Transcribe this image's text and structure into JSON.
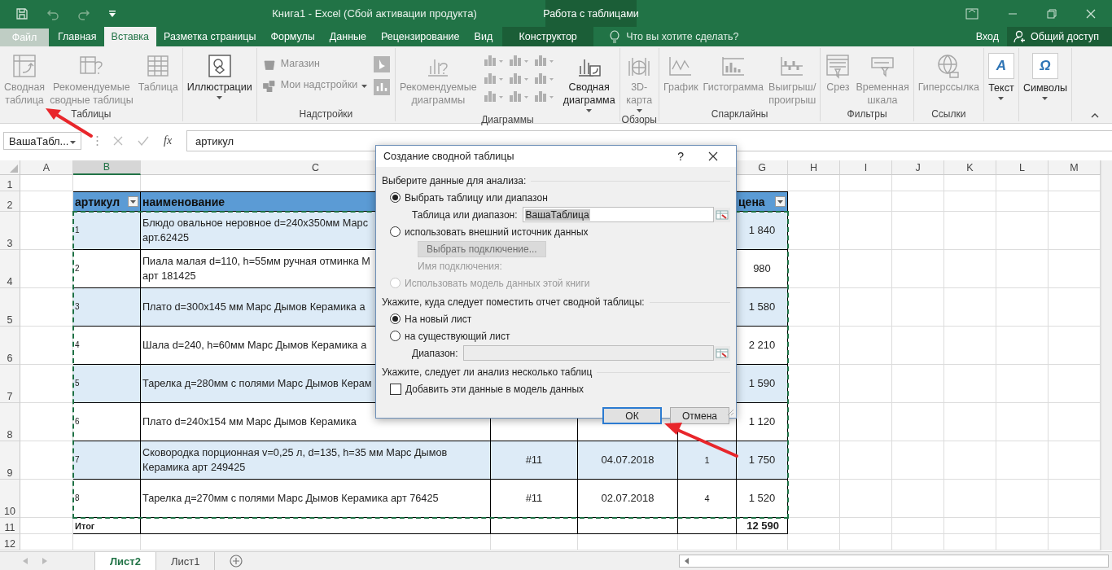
{
  "title_bar": {
    "title": "Книга1 - Excel (Сбой активации продукта)",
    "context_title": "Работа с таблицами"
  },
  "tabs": [
    {
      "label": "Файл",
      "kind": "file",
      "selected": false
    },
    {
      "label": "Главная",
      "kind": "tab",
      "selected": false
    },
    {
      "label": "Вставка",
      "kind": "tab",
      "selected": true
    },
    {
      "label": "Разметка страницы",
      "kind": "tab",
      "selected": false
    },
    {
      "label": "Формулы",
      "kind": "tab",
      "selected": false
    },
    {
      "label": "Данные",
      "kind": "tab",
      "selected": false
    },
    {
      "label": "Рецензирование",
      "kind": "tab",
      "selected": false
    },
    {
      "label": "Вид",
      "kind": "tab",
      "selected": false
    },
    {
      "label": "Конструктор",
      "kind": "context",
      "selected": false
    }
  ],
  "tell_me": {
    "placeholder": "Что вы хотите сделать?"
  },
  "sign_in": "Вход",
  "share": "Общий доступ",
  "ribbon_groups": [
    {
      "label": "Таблицы",
      "items": [
        {
          "kind": "large",
          "label": "Сводная\nтаблица",
          "disabled": true
        },
        {
          "kind": "large",
          "label": "Рекомендуемые\nсводные таблицы",
          "disabled": true
        },
        {
          "kind": "large",
          "label": "Таблица",
          "disabled": true
        }
      ]
    },
    {
      "items": [
        {
          "kind": "large",
          "label": "Иллюстрации",
          "dropdown": true,
          "disabled": false
        }
      ]
    },
    {
      "label": "Надстройки",
      "items": [
        {
          "kind": "stack",
          "entries": [
            {
              "label": "Магазин",
              "disabled": true
            },
            {
              "label": "Мои надстройки",
              "dropdown": true,
              "disabled": true
            }
          ]
        },
        {
          "kind": "icon_stack",
          "disabled": true
        }
      ]
    },
    {
      "label": "Диаграммы",
      "items": [
        {
          "kind": "large",
          "label": "Рекомендуемые\nдиаграммы",
          "disabled": true
        },
        {
          "kind": "gallery",
          "disabled": true
        },
        {
          "kind": "large",
          "label": "Сводная\nдиаграмма",
          "dropdown": true,
          "disabled": false
        }
      ]
    },
    {
      "label": "Обзоры",
      "items": [
        {
          "kind": "large",
          "label": "3D-\nкарта",
          "dropdown": true,
          "disabled": true
        }
      ]
    },
    {
      "label": "Спарклайны",
      "items": [
        {
          "kind": "large",
          "label": "График",
          "disabled": true
        },
        {
          "kind": "large",
          "label": "Гистограмма",
          "disabled": true
        },
        {
          "kind": "large",
          "label": "Выигрыш/\nпроигрыш",
          "disabled": true
        }
      ]
    },
    {
      "label": "Фильтры",
      "items": [
        {
          "kind": "large",
          "label": "Срез",
          "disabled": true
        },
        {
          "kind": "large",
          "label": "Временная\nшкала",
          "disabled": true
        }
      ]
    },
    {
      "label": "Ссылки",
      "items": [
        {
          "kind": "large",
          "label": "Гиперссылка",
          "disabled": true
        }
      ]
    },
    {
      "items": [
        {
          "kind": "glyph",
          "glyph": "A",
          "label": "Текст",
          "dropdown": true,
          "disabled": false
        }
      ]
    },
    {
      "items": [
        {
          "kind": "glyph",
          "glyph": "Ω",
          "label": "Символы",
          "dropdown": true,
          "disabled": false
        }
      ]
    }
  ],
  "formula_bar": {
    "name_box": "ВашаТабл...",
    "function_label": "fx",
    "value": "артикул"
  },
  "columns": [
    {
      "header": "A",
      "selected": false
    },
    {
      "header": "B",
      "selected": true
    },
    {
      "header": "C",
      "selected": false
    },
    {},
    {},
    {},
    {
      "header": "G",
      "selected": false
    },
    {
      "header": "H",
      "selected": false
    },
    {
      "header": "I",
      "selected": false
    },
    {
      "header": "J",
      "selected": false
    },
    {
      "header": "K",
      "selected": false
    },
    {
      "header": "L",
      "selected": false
    },
    {
      "header": "M",
      "selected": false
    }
  ],
  "rows": [
    {
      "number": "1",
      "kind": "blank"
    },
    {
      "number": "2",
      "kind": "header",
      "cells": {
        "b": "артикул",
        "c": "наименование",
        "g": "цена"
      }
    },
    {
      "number": "3",
      "kind": "data",
      "banded": true,
      "cells": {
        "b": "1",
        "c": "Блюдо овальное неровное d=240x350мм Марс\nарт.62425",
        "g": "1 840"
      }
    },
    {
      "number": "4",
      "kind": "data",
      "banded": false,
      "cells": {
        "b": "2",
        "c": "Пиала малая d=110, h=55мм ручная отминка М\nарт 181425",
        "g": "980"
      }
    },
    {
      "number": "5",
      "kind": "data",
      "banded": true,
      "cells": {
        "b": "3",
        "c": "Плато d=300x145 мм Марс Дымов Керамика а",
        "g": "1 580"
      }
    },
    {
      "number": "6",
      "kind": "data",
      "banded": false,
      "cells": {
        "b": "4",
        "c": "Шала d=240, h=60мм  Марс Дымов Керамика а",
        "g": "2 210"
      }
    },
    {
      "number": "7",
      "kind": "data",
      "banded": true,
      "cells": {
        "b": "5",
        "c": "Тарелка д=280мм с полями Марс Дымов Керам",
        "g": "1 590"
      }
    },
    {
      "number": "8",
      "kind": "data",
      "banded": false,
      "cells": {
        "b": "6",
        "c": "Плато d=240x154 мм Марс Дымов Керамика",
        "g": "1 120"
      }
    },
    {
      "number": "9",
      "kind": "data",
      "banded": true,
      "cells": {
        "b": "7",
        "c": "Сковородка порционная v=0,25 л, d=135, h=35 мм Марс Дымов\nКерамика арт 249425",
        "d": "#11",
        "e": "04.07.2018",
        "f": "1",
        "g": "1 750"
      }
    },
    {
      "number": "10",
      "kind": "data",
      "banded": false,
      "cells": {
        "b": "8",
        "c": "Тарелка д=270мм с полями Марс Дымов Керамика арт 76425",
        "d": "#11",
        "e": "02.07.2018",
        "f": "4",
        "g": "1 520"
      }
    },
    {
      "number": "11",
      "kind": "total",
      "cells": {
        "b": "Итог",
        "g": "12 590"
      }
    },
    {
      "number": "12",
      "kind": "blank"
    }
  ],
  "sheets": [
    {
      "label": "Лист2",
      "selected": true
    },
    {
      "label": "Лист1",
      "selected": false
    }
  ],
  "dialog": {
    "title": "Создание сводной таблицы",
    "help_label": "?",
    "source_heading": "Выберите данные для анализа:",
    "source_options": [
      {
        "label": "Выбрать таблицу или диапазон",
        "selected": true,
        "disabled": false
      },
      {
        "label": "использовать внешний источник данных",
        "selected": false,
        "disabled": false
      },
      {
        "label": "Использовать модель данных этой книги",
        "selected": false,
        "disabled": true
      }
    ],
    "range_label": "Таблица или диапазон:",
    "range_value": "ВашаТаблица",
    "connection_button": {
      "label": "Выбрать подключение...",
      "disabled": true
    },
    "connection_label": "Имя подключения:",
    "target_heading": "Укажите, куда следует поместить отчет сводной таблицы:",
    "target_options": [
      {
        "label": "На новый лист",
        "selected": true
      },
      {
        "label": "на существующий лист",
        "selected": false
      }
    ],
    "location_label": "Диапазон:",
    "location_disabled": true,
    "multi_heading": "Укажите, следует ли анализ несколько таблиц",
    "add_to_model": {
      "label": "Добавить эти данные в модель данных",
      "checked": false
    },
    "buttons": [
      {
        "label": "ОК",
        "default": true
      },
      {
        "label": "Отмена",
        "default": false
      }
    ]
  }
}
